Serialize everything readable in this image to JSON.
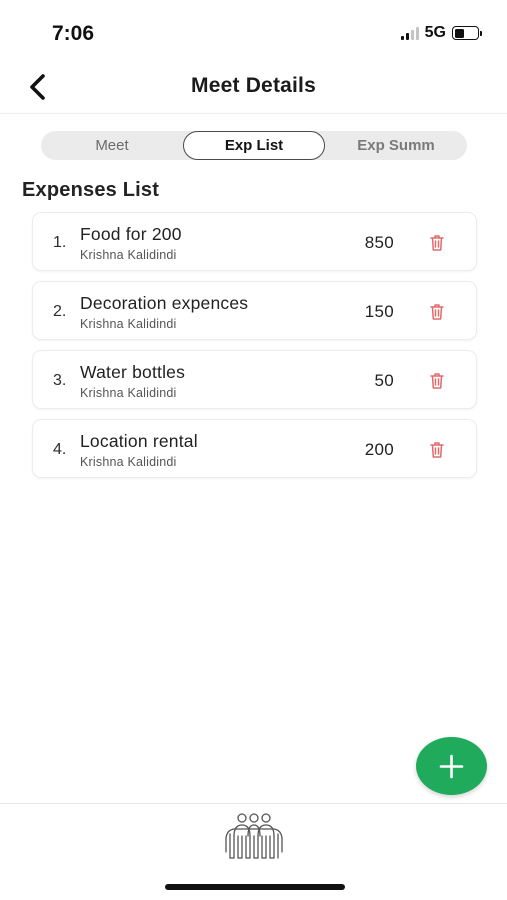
{
  "status_bar": {
    "time": "7:06",
    "network": "5G",
    "battery_level": 0.35
  },
  "header": {
    "title": "Meet Details",
    "back_icon": "chevron-left-icon"
  },
  "tabs": [
    {
      "label": "Meet",
      "selected": false
    },
    {
      "label": "Exp List",
      "selected": true
    },
    {
      "label": "Exp Summ",
      "selected": false
    }
  ],
  "section_title": "Expenses List",
  "expenses": [
    {
      "index": "1.",
      "name": "Food for 200",
      "owner": "Krishna Kalidindi",
      "amount": "850"
    },
    {
      "index": "2.",
      "name": "Decoration expences",
      "owner": "Krishna Kalidindi",
      "amount": "150"
    },
    {
      "index": "3.",
      "name": "Water bottles",
      "owner": "Krishna Kalidindi",
      "amount": "50"
    },
    {
      "index": "4.",
      "name": "Location rental",
      "owner": "Krishna Kalidindi",
      "amount": "200"
    }
  ],
  "icons": {
    "delete": "trash-icon",
    "add": "plus-icon",
    "bottom_nav": "group-people-icon"
  },
  "colors": {
    "accent_green": "#1faa5c",
    "delete_red": "#e06a6a",
    "segment_bg": "#ebebeb"
  }
}
